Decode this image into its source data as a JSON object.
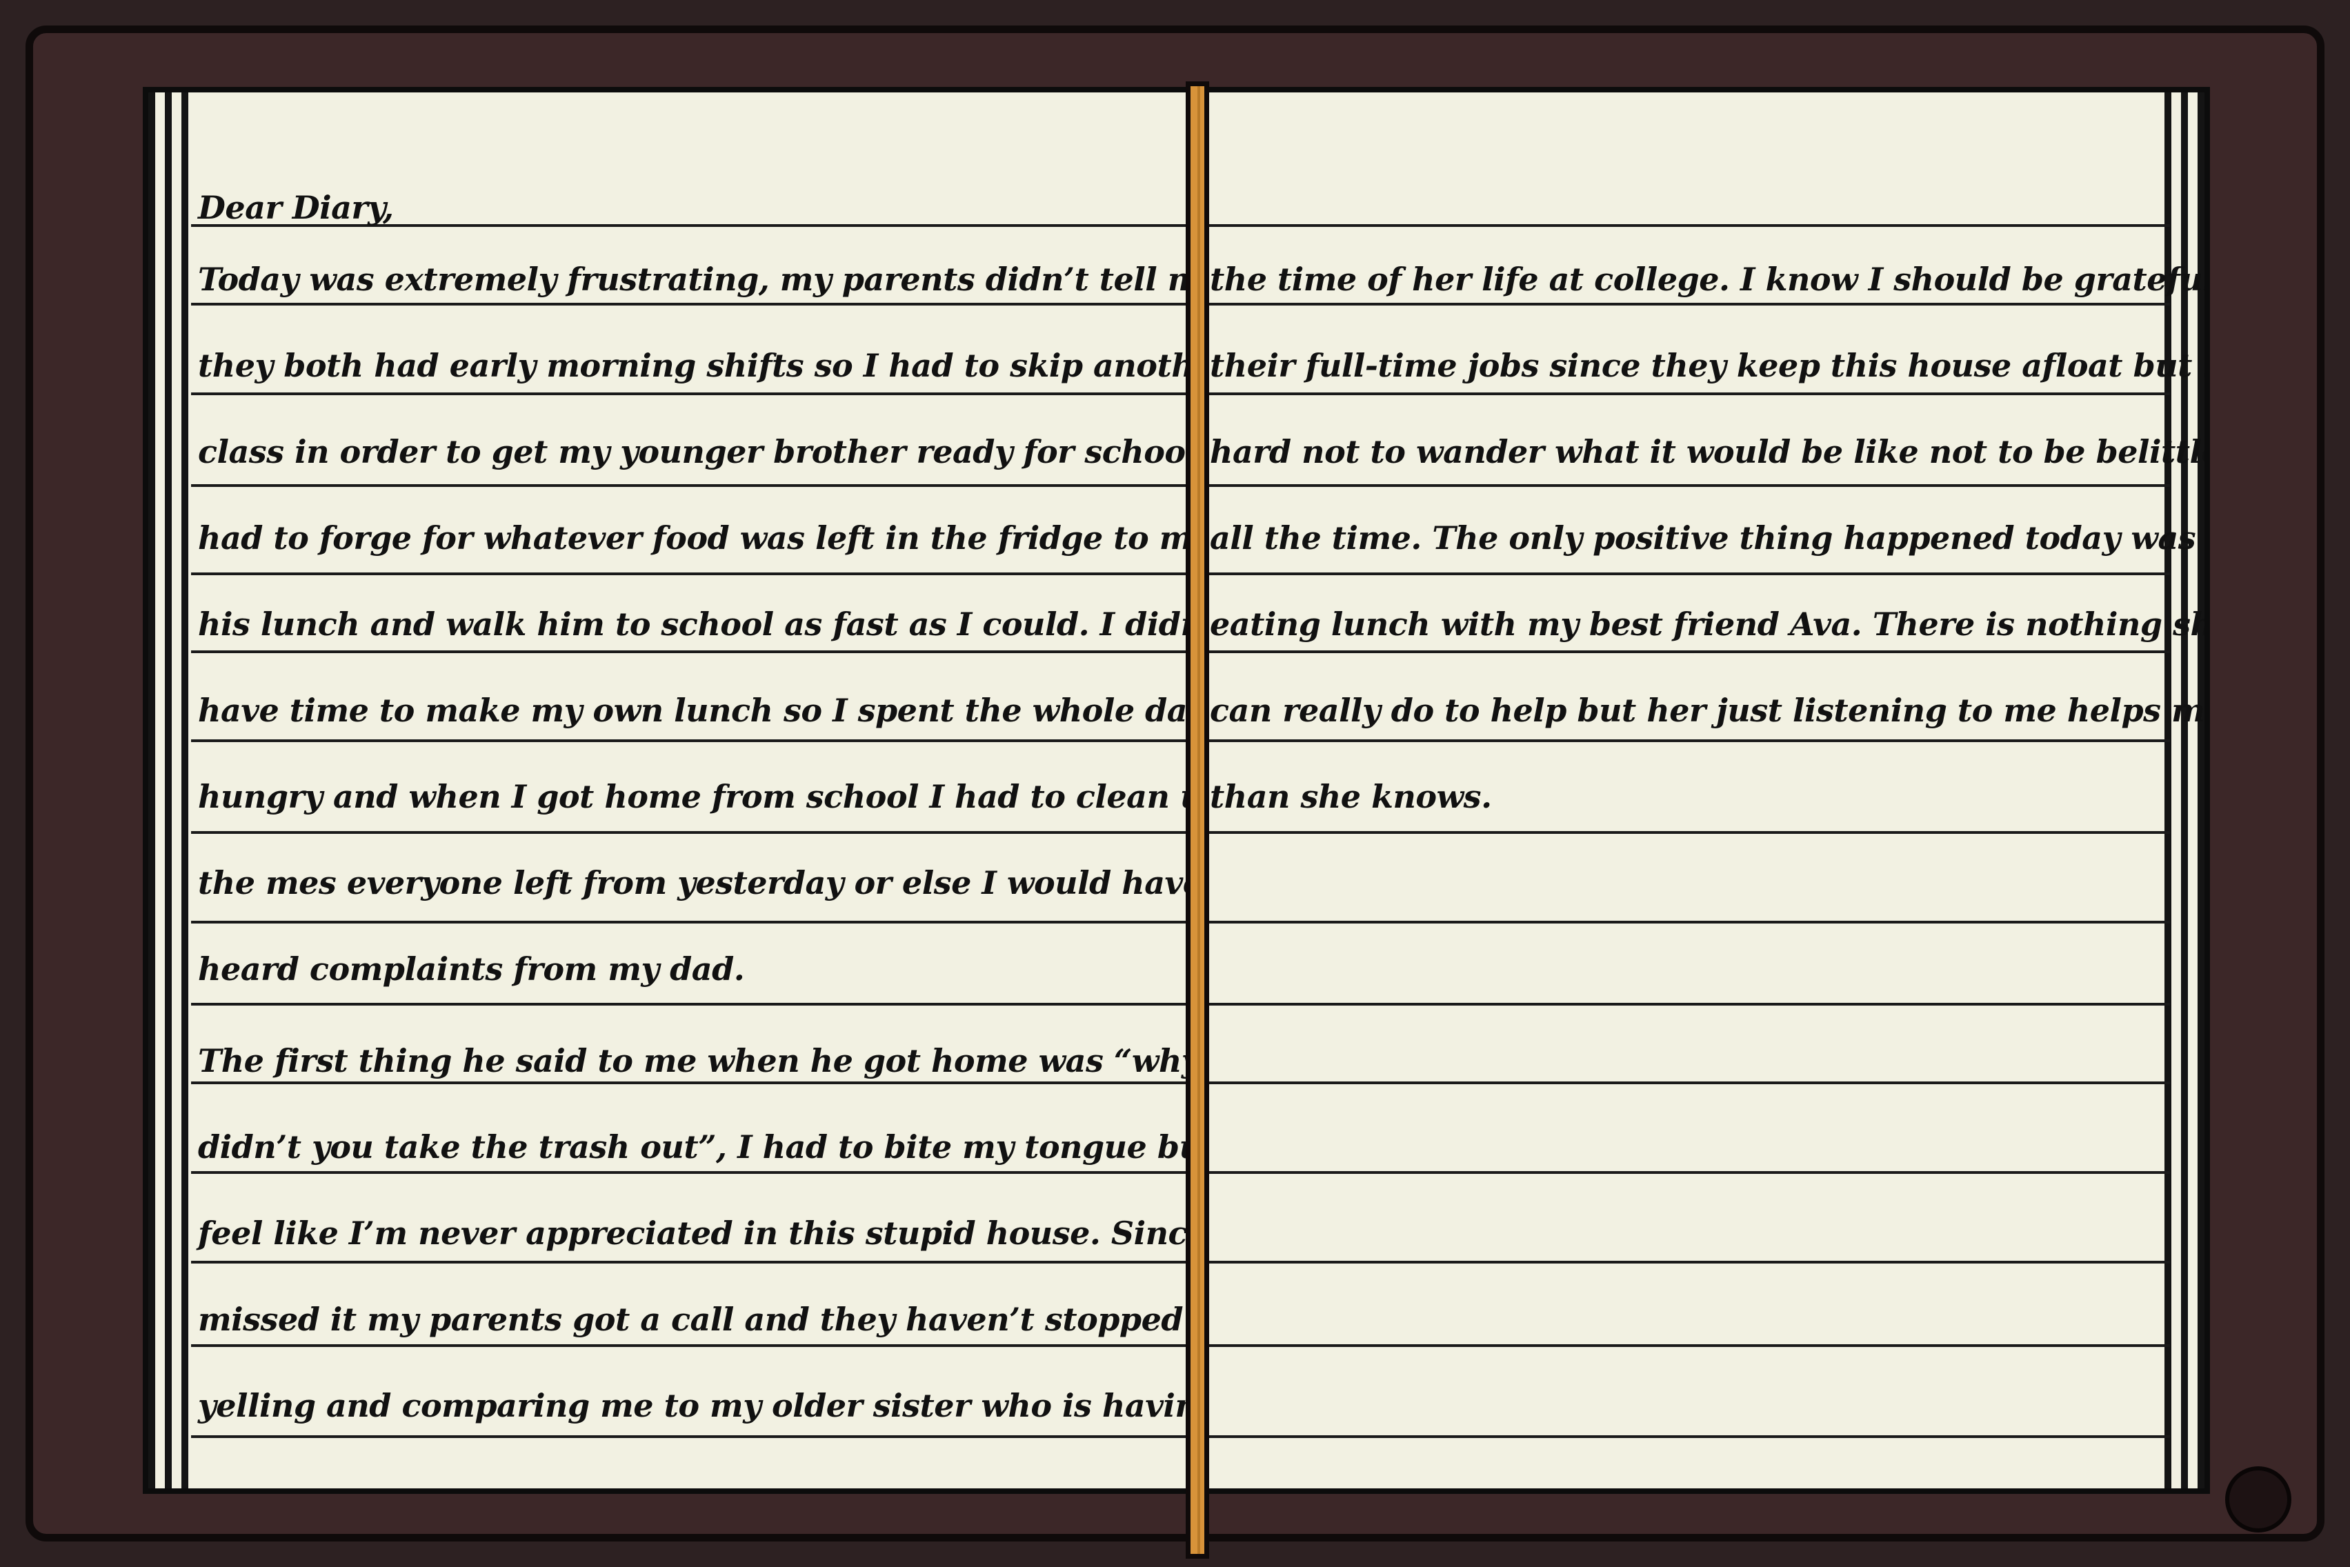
{
  "diary": {
    "left_page": {
      "greeting": "Dear Diary,",
      "lines": [
        "Today was extremely frustrating, my parents didn’t tell me",
        "they both had early morning shifts so I had to skip another",
        "class in order to get my younger brother ready for school. I",
        "had to forge for whatever food was left in the fridge to make",
        "his lunch and walk him to school as fast as I could. I didn’t",
        "have time to make my own lunch so I spent the whole day",
        "hungry and when I got home from school I had to clean up",
        "the mes everyone left from yesterday or else I would have",
        "heard complaints from my dad.",
        "The first thing he said to me when he got home was “why",
        "didn’t you take the trash out”, I had to bite my tongue but I",
        "feel like I’m never appreciated in this stupid house. Since I",
        "missed it my parents got a call and they haven’t stopped",
        "yelling and comparing me to my older sister who is having"
      ]
    },
    "right_page": {
      "lines": [
        "the time of her life at college. I know I should be grateful for",
        "their full-time jobs since they keep this house afloat but it’s",
        "hard not to wander what it would be like not to be belittled",
        "all the time. The only positive thing happened today was",
        "eating lunch with my best friend Ava. There is nothing she",
        "can really do to help but her just listening to me helps more",
        "than she knows."
      ]
    }
  }
}
